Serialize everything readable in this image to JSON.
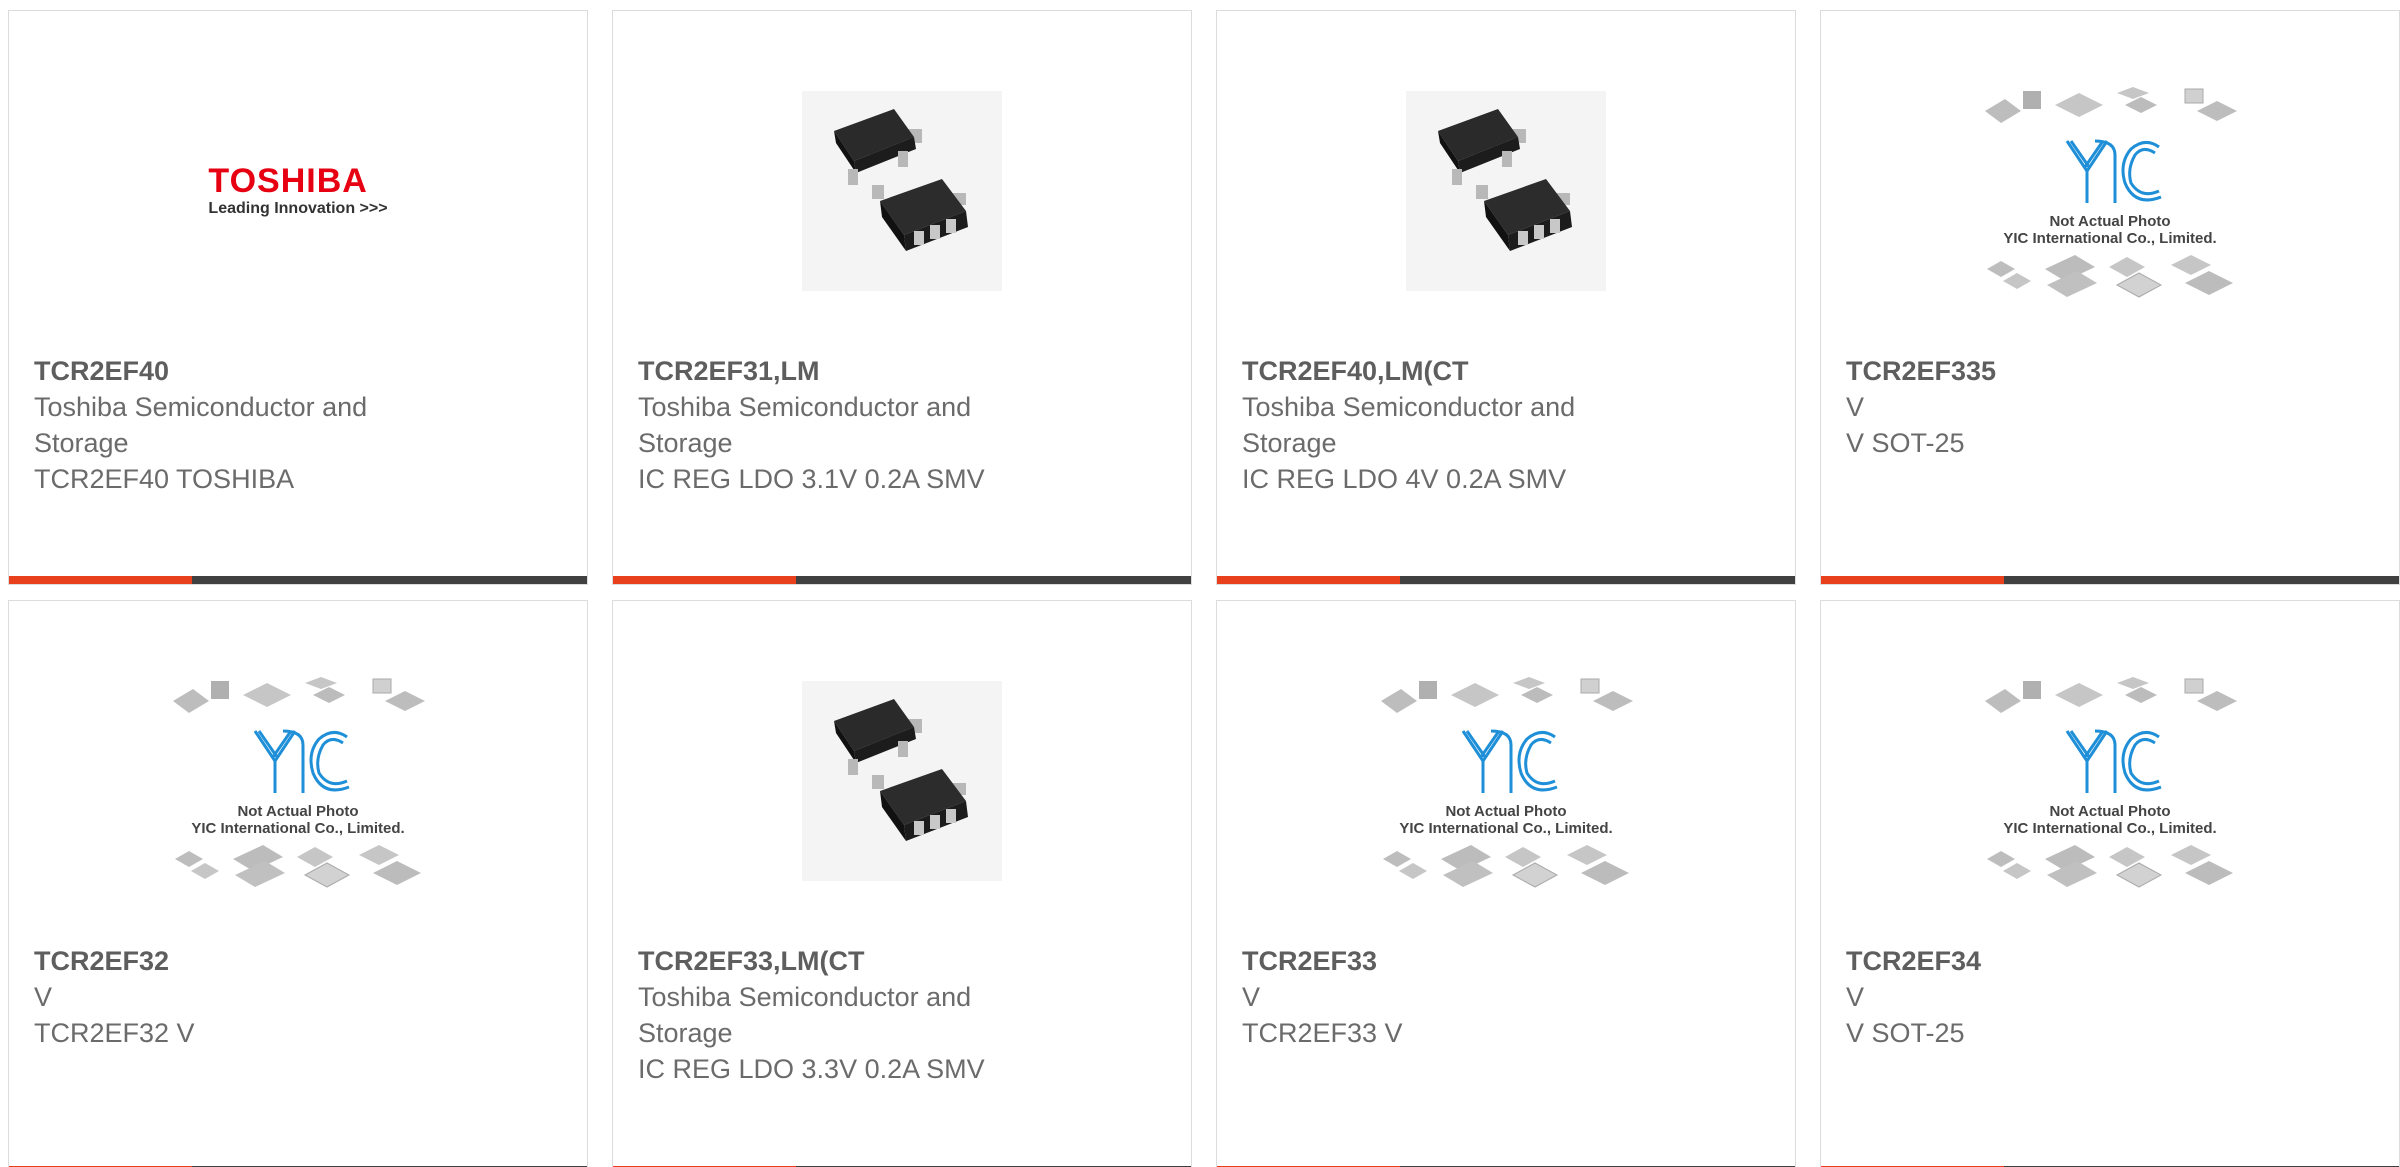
{
  "colors": {
    "accent": "#e8401c",
    "bar": "#404040",
    "toshiba_red": "#e60012",
    "yic_blue": "#1f8fd8"
  },
  "products": [
    {
      "part_number": "TCR2EF40",
      "lines": [
        "Toshiba Semiconductor and",
        "Storage",
        "TCR2EF40 TOSHIBA"
      ],
      "image": "toshiba-logo",
      "logo": {
        "brand": "TOSHIBA",
        "slogan": "Leading Innovation >>>"
      }
    },
    {
      "part_number": "TCR2EF31,LM",
      "lines": [
        "Toshiba Semiconductor and",
        "Storage",
        "IC REG LDO 3.1V 0.2A SMV"
      ],
      "image": "sot25-chip-photo"
    },
    {
      "part_number": "TCR2EF40,LM(CT",
      "lines": [
        "Toshiba Semiconductor and",
        "Storage",
        "IC REG LDO 4V 0.2A SMV"
      ],
      "image": "sot25-chip-photo"
    },
    {
      "part_number": "TCR2EF335",
      "lines": [
        "V",
        "V SOT-25"
      ],
      "image": "yic-placeholder"
    },
    {
      "part_number": "TCR2EF32",
      "lines": [
        "V",
        "TCR2EF32 V"
      ],
      "image": "yic-placeholder"
    },
    {
      "part_number": "TCR2EF33,LM(CT",
      "lines": [
        "Toshiba Semiconductor and",
        "Storage",
        "IC REG LDO 3.3V 0.2A SMV"
      ],
      "image": "sot25-chip-photo"
    },
    {
      "part_number": "TCR2EF33",
      "lines": [
        "V",
        "TCR2EF33 V"
      ],
      "image": "yic-placeholder"
    },
    {
      "part_number": "TCR2EF34",
      "lines": [
        "V",
        "V SOT-25"
      ],
      "image": "yic-placeholder"
    }
  ],
  "placeholder_caption": {
    "line1": "Not Actual Photo",
    "line2": "YIC International Co., Limited."
  }
}
